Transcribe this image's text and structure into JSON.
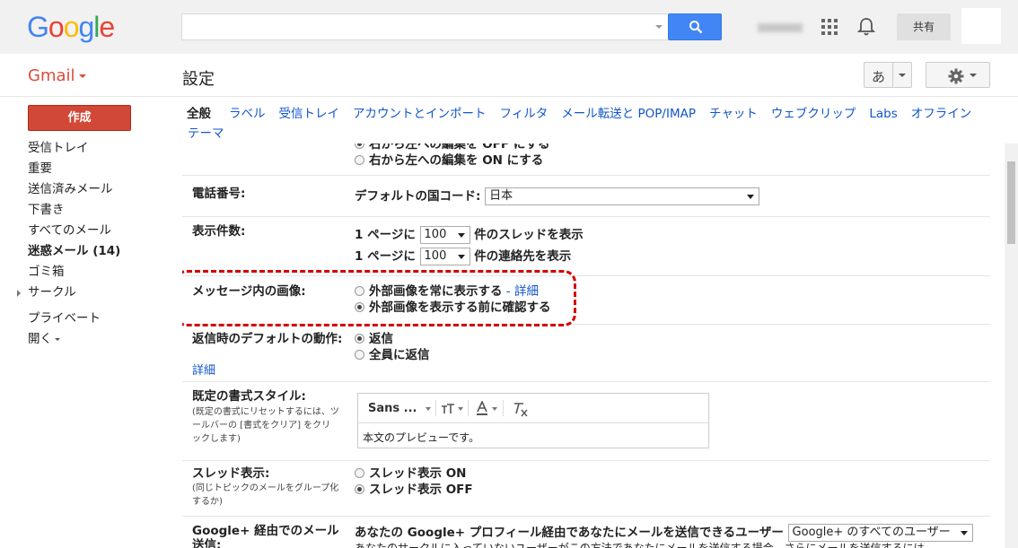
{
  "header": {
    "logo_letters": [
      {
        "char": "G",
        "color": "#4285f4"
      },
      {
        "char": "o",
        "color": "#ea4335"
      },
      {
        "char": "o",
        "color": "#fbbc05"
      },
      {
        "char": "g",
        "color": "#4285f4"
      },
      {
        "char": "l",
        "color": "#34a853"
      },
      {
        "char": "e",
        "color": "#ea4335"
      }
    ],
    "search_value": "",
    "search_icon": "search-icon",
    "apps_icon": "apps-grid-icon",
    "notifications_icon": "bell-icon",
    "share_label": "共有"
  },
  "subheader": {
    "app_label": "Gmail",
    "page_title": "設定",
    "ime_label": "あ",
    "settings_icon": "gear-icon"
  },
  "sidebar": {
    "compose_label": "作成",
    "items": [
      {
        "label": "受信トレイ"
      },
      {
        "label": "重要"
      },
      {
        "label": "送信済みメール"
      },
      {
        "label": "下書き"
      },
      {
        "label": "すべてのメール"
      },
      {
        "label": "迷惑メール (14)"
      },
      {
        "label": "ゴミ箱"
      },
      {
        "label": "サークル"
      },
      {
        "label": "プライベート"
      },
      {
        "label": "開く"
      }
    ]
  },
  "tabs": [
    {
      "label": "全般"
    },
    {
      "label": "ラベル"
    },
    {
      "label": "受信トレイ"
    },
    {
      "label": "アカウントとインポート"
    },
    {
      "label": "フィルタ"
    },
    {
      "label": "メール転送と POP/IMAP"
    },
    {
      "label": "チャット"
    },
    {
      "label": "ウェブクリップ"
    },
    {
      "label": "Labs"
    },
    {
      "label": "オフライン"
    },
    {
      "label": "テーマ"
    }
  ],
  "settings": {
    "rtl": {
      "option_off": "右から左への編集を OFF にする",
      "option_on": "右から左への編集を ON にする"
    },
    "phone": {
      "label": "電話番号:",
      "country_label": "デフォルトの国コード:",
      "country_value": "日本"
    },
    "page_size": {
      "label": "表示件数:",
      "prefix": "1 ページに",
      "threads_value": "100",
      "threads_suffix": "件のスレッドを表示",
      "contacts_value": "100",
      "contacts_suffix": "件の連絡先を表示"
    },
    "images": {
      "label": "メッセージ内の画像:",
      "option_always": "外部画像を常に表示する",
      "separator": " - ",
      "details_link": "詳細",
      "option_ask": "外部画像を表示する前に確認する",
      "selected": "ask"
    },
    "reply": {
      "label": "返信時のデフォルトの動作:",
      "details_link": "詳細",
      "option_reply": "返信",
      "option_reply_all": "全員に返信",
      "selected": "reply"
    },
    "text_style": {
      "label": "既定の書式スタイル:",
      "note": "(既定の書式にリセットするには、ツールバーの [書式をクリア] をクリックします)",
      "font_name": "Sans ...",
      "preview_text": "本文のプレビューです。"
    },
    "conversation": {
      "label": "スレッド表示:",
      "note": "(同じトピックのメールをグループ化するか)",
      "option_on": "スレッド表示 ON",
      "option_off": "スレッド表示 OFF",
      "selected": "off"
    },
    "google_plus": {
      "label": "Google+ 経由でのメール送信:",
      "description": "あなたの Google+ プロフィール経由であなたにメールを送信できるユーザー",
      "select_value": "Google+ のすべてのユーザー",
      "description2": "あなたのサークルに入っていないユーザーがこの方法であなたにメールを送信する場合、さらにメールを送信するには"
    }
  },
  "colors": {
    "accent_red": "#d14836",
    "link_blue": "#1155cc",
    "search_blue": "#4285f4",
    "highlight_dash": "#d40000"
  }
}
